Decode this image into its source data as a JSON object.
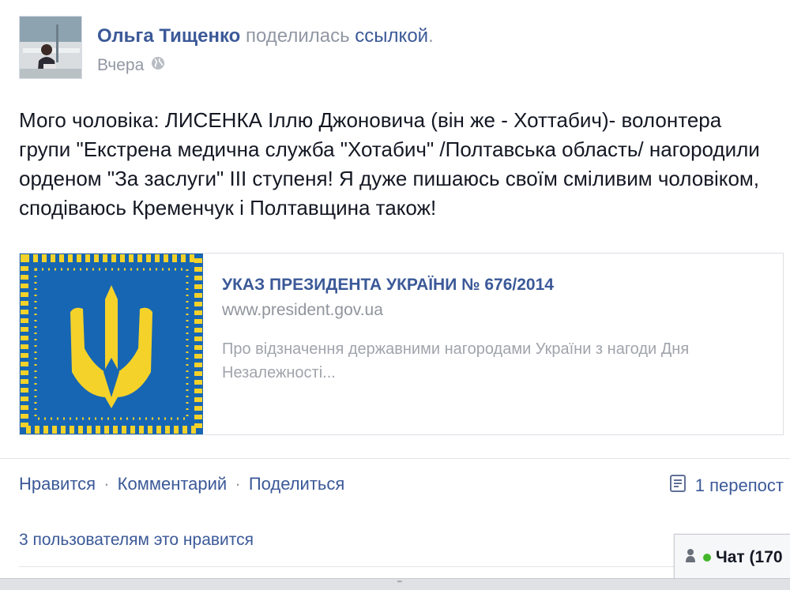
{
  "post": {
    "author": "Ольга Тищенко",
    "action_text": "поделилась",
    "action_link": "ссылкой",
    "action_end": ".",
    "time": "Вчера",
    "text": "Мого чоловіка: ЛИСЕНКА Іллю Джоновича (він же - Хоттабич)- волонтера групи \"Екстрена медична служба \"Хотабич\" /Полтавська область/ нагородили орденом \"За заслуги\" ІІІ ступеня! Я дуже пишаюсь своїм сміливим чоловіком, сподіваюсь Кременчук і Полтавщина також!"
  },
  "link_card": {
    "title": "УКАЗ ПРЕЗИДЕНТА УКРАЇНИ № 676/2014",
    "domain": "www.president.gov.ua",
    "description": "Про відзначення державними нагородами України з нагоди Дня Незалежності..."
  },
  "actions": {
    "like": "Нравится",
    "comment": "Комментарий",
    "share": "Поделиться",
    "sep": "·",
    "reposts": "1 перепост"
  },
  "likes": {
    "text": "3 пользователям это нравится"
  },
  "chat": {
    "label": "Чат (170"
  },
  "bottombar": {
    "grip": "'''"
  },
  "colors": {
    "link": "#3b5998",
    "meta": "#9197a3",
    "flag_blue": "#1766b3",
    "flag_yellow": "#f5d22a"
  }
}
